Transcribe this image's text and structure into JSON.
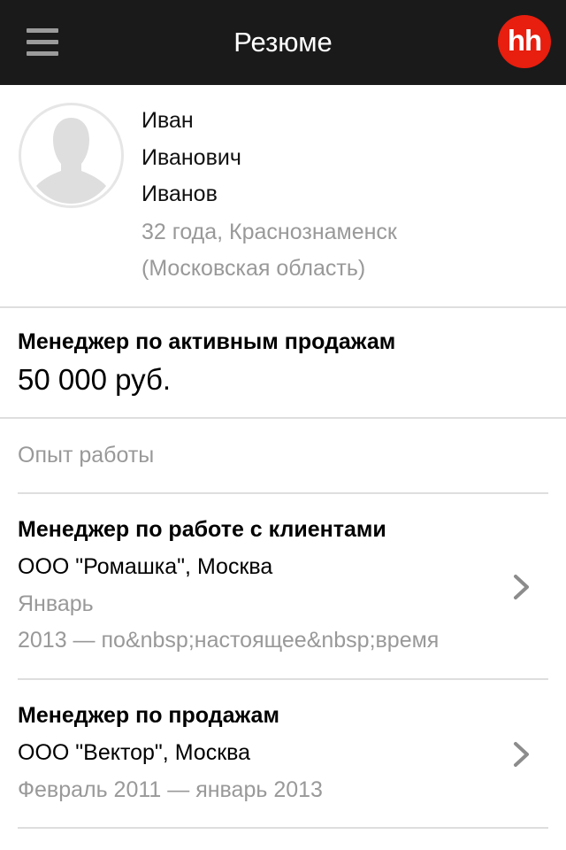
{
  "header": {
    "title": "Резюме",
    "logo_text": "hh",
    "logo_color": "#e81e0e",
    "background": "#1a1a1a"
  },
  "profile": {
    "first_name": "Иван",
    "patronymic": "Иванович",
    "last_name": "Иванов",
    "age_city": "32 года, Краснознаменск",
    "region": "(Московская область)"
  },
  "desired": {
    "position": "Менеджер по активным продажам",
    "salary": "50 000 руб."
  },
  "experience": {
    "section_title": "Опыт работы",
    "jobs": [
      {
        "title": "Менеджер по работе с клиентами",
        "company": "ООО \"Ромашка\", Москва",
        "period_line1": "Январь",
        "period_line2": "2013 — по&nbsp;настоящее&nbsp;время"
      },
      {
        "title": "Менеджер по продажам",
        "company": "ООО \"Вектор\", Москва",
        "period_line1": "Февраль 2011 — январь 2013"
      }
    ]
  }
}
